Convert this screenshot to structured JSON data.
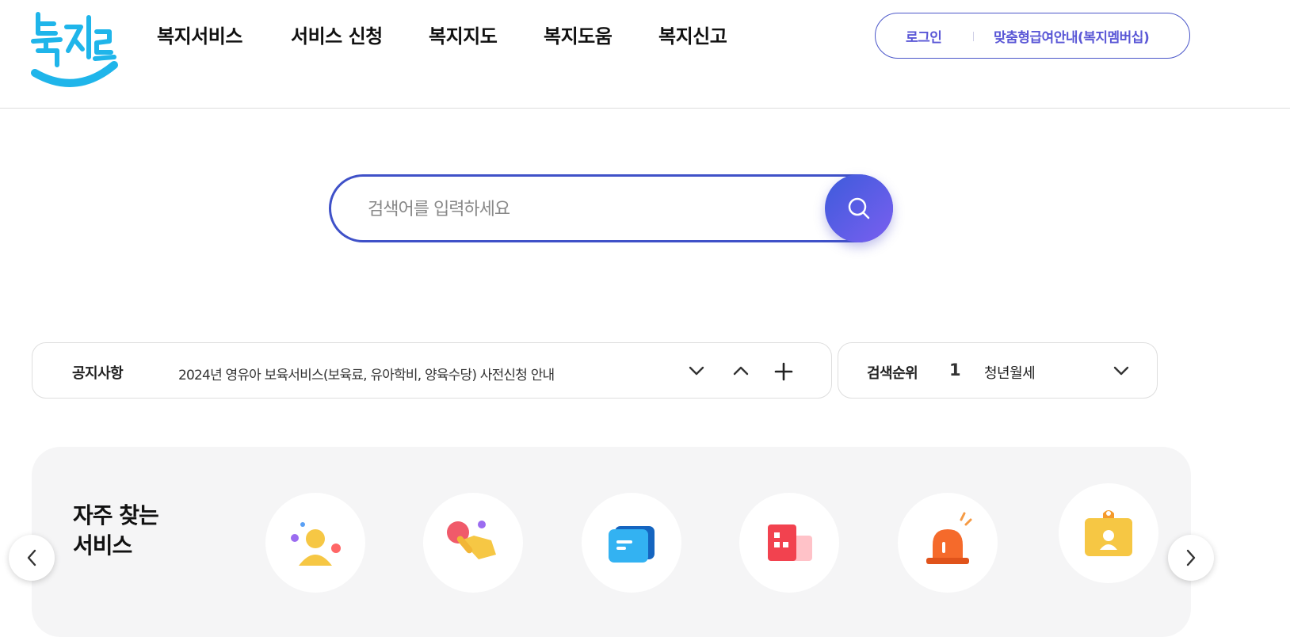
{
  "header": {
    "logo_text": "복지로",
    "nav": [
      "복지서비스",
      "서비스 신청",
      "복지지도",
      "복지도움",
      "복지신고"
    ],
    "login": "로그인",
    "membership": "맞춤형급여안내(복지멤버십)"
  },
  "search": {
    "placeholder": "검색어를 입력하세요",
    "icon": "search-icon"
  },
  "notice": {
    "label": "공지사항",
    "text": "2024년 영유아 보육서비스(보육료, 유아학비, 양육수당) 사전신청 안내",
    "controls": [
      "chevron-down-icon",
      "chevron-up-icon",
      "plus-icon"
    ]
  },
  "ranking": {
    "label": "검색순위",
    "rank": "1",
    "keyword": "청년월세"
  },
  "frequent": {
    "title_line1": "자주 찾는",
    "title_line2": "서비스",
    "icons": [
      "person-icon",
      "tap-hand-icon",
      "message-card-icon",
      "building-icon",
      "siren-icon",
      "id-badge-icon"
    ]
  },
  "colors": {
    "accent": "#3f51c8",
    "membership_text": "#5a57d6",
    "logo": "#1fb5ea"
  }
}
